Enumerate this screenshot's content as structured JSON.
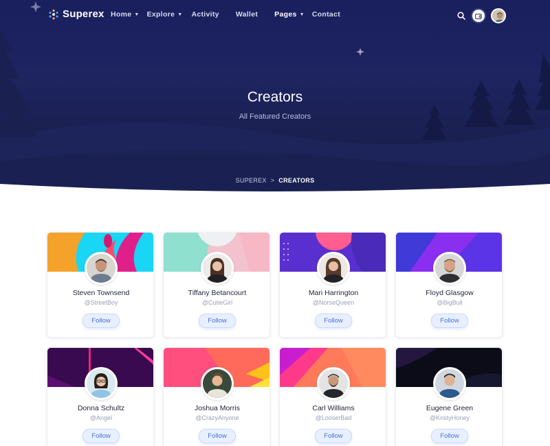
{
  "brand": {
    "name": "Superex",
    "accent": "#4a6fd8",
    "hero_bg": "#1a1f5e"
  },
  "nav": {
    "items": [
      {
        "label": "Home",
        "has_dropdown": true
      },
      {
        "label": "Explore",
        "has_dropdown": true
      },
      {
        "label": "Activity",
        "has_dropdown": false
      },
      {
        "label": "Wallet",
        "has_dropdown": false
      },
      {
        "label": "Pages",
        "has_dropdown": true,
        "active": true
      },
      {
        "label": "Contact",
        "has_dropdown": false
      }
    ],
    "icons": {
      "search": "search-icon",
      "wallet": "wallet-icon",
      "user": "user-avatar"
    }
  },
  "hero": {
    "title": "Creators",
    "subtitle": "All Featured Creators",
    "breadcrumb": {
      "home": "SUPEREX",
      "separator": ">",
      "current": "CREATORS"
    }
  },
  "creators": [
    {
      "name": "Steven Townsend",
      "handle": "@StreetBoy",
      "follow_label": "Follow"
    },
    {
      "name": "Tiffany Betancourt",
      "handle": "@CutieGirl",
      "follow_label": "Follow"
    },
    {
      "name": "Mari Harrington",
      "handle": "@NorseQueen",
      "follow_label": "Follow"
    },
    {
      "name": "Floyd Glasgow",
      "handle": "@BigBull",
      "follow_label": "Follow"
    },
    {
      "name": "Donna Schultz",
      "handle": "@Angel",
      "follow_label": "Follow"
    },
    {
      "name": "Joshua Morris",
      "handle": "@CrazyAnyone",
      "follow_label": "Follow"
    },
    {
      "name": "Carl Williams",
      "handle": "@LooserBad",
      "follow_label": "Follow"
    },
    {
      "name": "Eugene Green",
      "handle": "@KristyHoney",
      "follow_label": "Follow"
    }
  ]
}
